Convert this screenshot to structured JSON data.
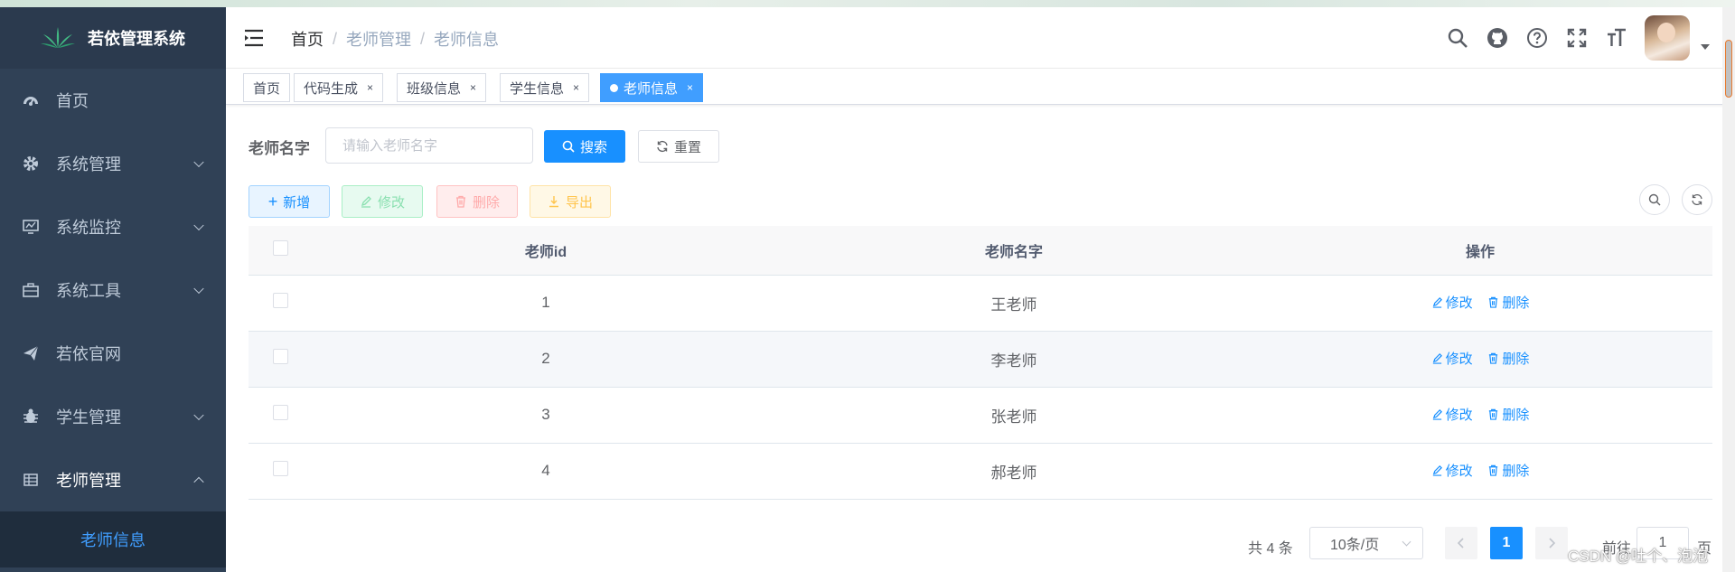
{
  "app": {
    "title": "若依管理系统"
  },
  "sidebar": {
    "items": [
      {
        "label": "首页",
        "icon": "dashboard-icon"
      },
      {
        "label": "系统管理",
        "icon": "gear-icon"
      },
      {
        "label": "系统监控",
        "icon": "monitor-icon"
      },
      {
        "label": "系统工具",
        "icon": "toolbox-icon"
      },
      {
        "label": "若依官网",
        "icon": "paper-plane-icon"
      },
      {
        "label": "学生管理",
        "icon": "bug-icon"
      },
      {
        "label": "老师管理",
        "icon": "table-icon"
      }
    ],
    "active_sub": "老师信息"
  },
  "breadcrumb": {
    "home": "首页",
    "sep": "/",
    "level1": "老师管理",
    "level2": "老师信息"
  },
  "tags": [
    {
      "label": "首页"
    },
    {
      "label": "代码生成",
      "close": "×"
    },
    {
      "label": "班级信息",
      "close": "×"
    },
    {
      "label": "学生信息",
      "close": "×"
    },
    {
      "label": "老师信息",
      "close": "×",
      "active": true
    }
  ],
  "search": {
    "label": "老师名字",
    "placeholder": "请输入老师名字",
    "search_btn": "搜索",
    "reset_btn": "重置"
  },
  "toolbar": {
    "add": "新增",
    "edit": "修改",
    "delete": "删除",
    "export": "导出"
  },
  "table": {
    "headers": [
      "老师id",
      "老师名字",
      "操作"
    ],
    "rows": [
      {
        "id": "1",
        "name": "王老师"
      },
      {
        "id": "2",
        "name": "李老师"
      },
      {
        "id": "3",
        "name": "张老师"
      },
      {
        "id": "4",
        "name": "郝老师"
      }
    ],
    "row_edit": "修改",
    "row_delete": "删除"
  },
  "pagination": {
    "total": "共 4 条",
    "page_size": "10条/页",
    "current": "1",
    "goto_prefix": "前往",
    "goto_value": "1",
    "goto_suffix": "页"
  },
  "watermark": "CSDN @吐个、泡泡",
  "colors": {
    "sidebar_bg": "#304156",
    "primary": "#1890ff",
    "active_tag": "#409eff"
  }
}
